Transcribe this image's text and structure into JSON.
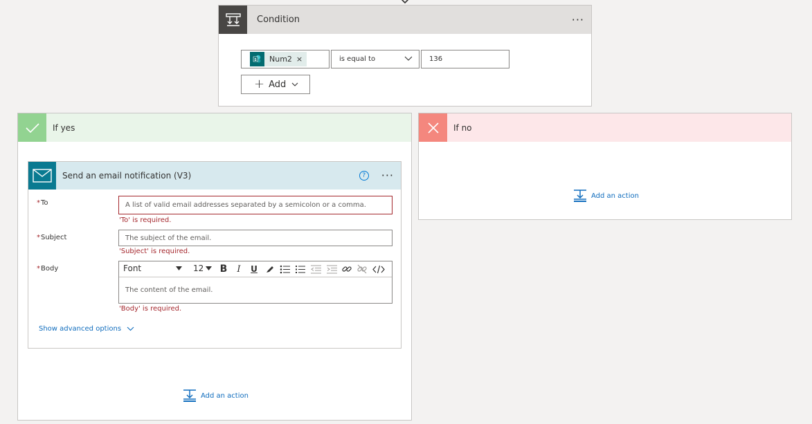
{
  "condition": {
    "title": "Condition",
    "more_label": "···",
    "left_token": "Num2",
    "token_remove": "×",
    "operator": "is equal to",
    "value": "136",
    "add_label": "Add"
  },
  "if_yes": {
    "label": "If yes",
    "email_card": {
      "title": "Send an email notification (V3)",
      "help_label": "?",
      "more_label": "···",
      "fields": {
        "to": {
          "label": "To",
          "required_mark": "*",
          "placeholder": "A list of valid email addresses separated by a semicolon or a comma.",
          "error": "'To' is required."
        },
        "subject": {
          "label": "Subject",
          "required_mark": "*",
          "placeholder": "The subject of the email.",
          "error": "'Subject' is required."
        },
        "body": {
          "label": "Body",
          "required_mark": "*",
          "placeholder": "The content of the email.",
          "error": "'Body' is required.",
          "font": "Font",
          "font_size": "12",
          "bold": "B",
          "italic": "I",
          "underline": "U"
        }
      },
      "advanced_label": "Show advanced options"
    },
    "add_action_label": "Add an action"
  },
  "if_no": {
    "label": "If no",
    "add_action_label": "Add an action"
  },
  "colors": {
    "accent": "#0f6cbd",
    "error": "#a4262c",
    "yes": "#92d391",
    "no": "#f4877e",
    "email_icon": "#0a7a91"
  }
}
